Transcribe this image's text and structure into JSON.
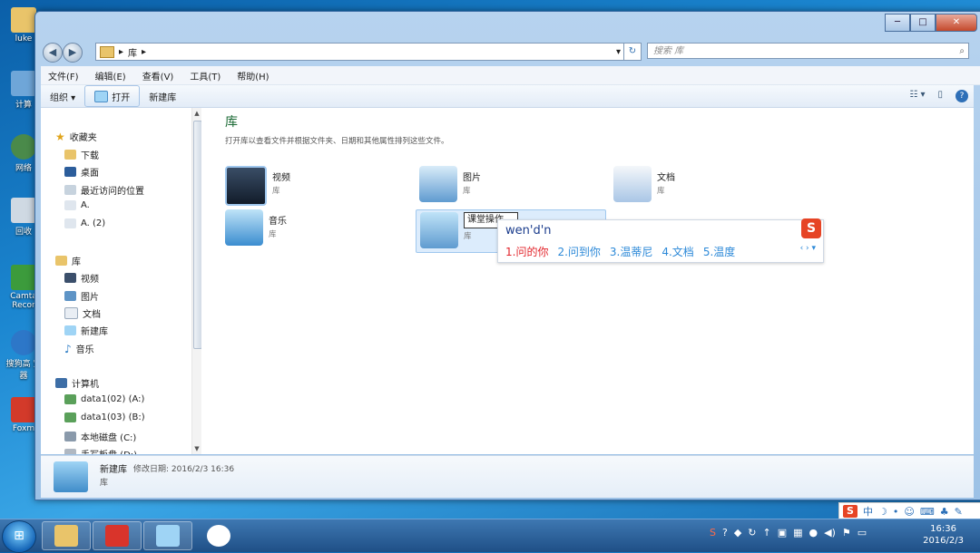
{
  "desktop": {
    "icons": [
      "luke",
      "计算",
      "网络",
      "回收",
      "Camta Recor",
      "搜狗高 览器",
      "Foxm"
    ]
  },
  "window": {
    "address": {
      "crumb": "库"
    },
    "search_placeholder": "搜索 库",
    "menu": [
      "文件(F)",
      "编辑(E)",
      "查看(V)",
      "工具(T)",
      "帮助(H)"
    ],
    "toolbar": {
      "organize": "组织 ▾",
      "open": "打开",
      "new_library": "新建库"
    }
  },
  "nav": {
    "favorites": {
      "label": "收藏夹",
      "items": [
        "下载",
        "桌面",
        "最近访问的位置",
        "A.",
        "A. (2)"
      ]
    },
    "libraries": {
      "label": "库",
      "items": [
        "视频",
        "图片",
        "文档",
        "新建库",
        "音乐"
      ]
    },
    "computer": {
      "label": "计算机",
      "items": [
        "data1(02) (A:)",
        "data1(03) (B:)",
        "本地磁盘 (C:)",
        "手写板盘 (D:)"
      ]
    }
  },
  "content": {
    "title": "库",
    "description": "打开库以查看文件并根据文件夹、日期和其他属性排列这些文件。",
    "libraries": [
      {
        "name": "视频",
        "type": "库"
      },
      {
        "name": "图片",
        "type": "库"
      },
      {
        "name": "文档",
        "type": "库"
      },
      {
        "name": "音乐",
        "type": "库"
      },
      {
        "name": "课堂操作",
        "type": "库"
      }
    ]
  },
  "ime": {
    "pinyin": "wen'd'n",
    "candidates": [
      "1.问的你",
      "2.问到你",
      "3.温蒂尼",
      "4.文档",
      "5.温度"
    ]
  },
  "details": {
    "name": "新建库",
    "modified": "修改日期: 2016/2/3 16:36",
    "type": "库"
  },
  "taskbar": {
    "time": "16:36",
    "date": "2016/2/3"
  },
  "lang_bar": {
    "mode": "中"
  }
}
